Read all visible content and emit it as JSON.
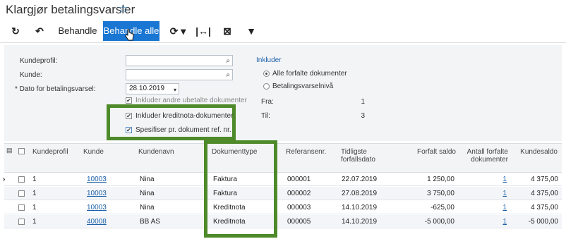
{
  "page": {
    "title": "Klargjør betalingsvarsler",
    "star_icon": "star-icon"
  },
  "toolbar": {
    "refresh_icon": "refresh-icon",
    "undo_icon": "undo-icon",
    "process_label": "Behandle",
    "process_all_label": "Behandle alle",
    "sync_icon": "sync-icon",
    "fit_icon": "fit-columns-icon",
    "export_icon": "export-excel-icon",
    "filter_icon": "filter-icon"
  },
  "form": {
    "customer_profile_label": "Kundeprofil:",
    "customer_label": "Kunde:",
    "date_label": "Dato for betalingsvarsel:",
    "date_value": "28.10.2019",
    "include_unpaid_label": "Inkluder andre ubetalte dokumenter",
    "include_credit_label": "Inkluder kreditnota-dokumenter",
    "specify_label": "Spesifiser pr. dokument ref. nr.",
    "include_heading": "Inkluder",
    "radio_all_label": "Alle forfalte dokumenter",
    "radio_level_label": "Betalingsvarselnivå",
    "from_label": "Fra:",
    "from_value": "1",
    "to_label": "Til:",
    "to_value": "3"
  },
  "grid": {
    "columns": [
      "Kundeprofil",
      "Kunde",
      "Kundenavn",
      "Dokumenttype",
      "Referansenr.",
      "Tidligste forfallsdato",
      "Forfalt saldo",
      "Antall forfalte dokumenter",
      "Kundesaldo"
    ],
    "rows": [
      {
        "profile": "1",
        "customer": "10003",
        "name": "Nina",
        "doctype": "Faktura",
        "ref": "000001",
        "date": "22.07.2019",
        "overdue": "1 250,00",
        "count": "1",
        "balance": "4 375,00"
      },
      {
        "profile": "1",
        "customer": "10003",
        "name": "Nina",
        "doctype": "Faktura",
        "ref": "000002",
        "date": "27.08.2019",
        "overdue": "3 750,00",
        "count": "1",
        "balance": "4 375,00"
      },
      {
        "profile": "1",
        "customer": "10003",
        "name": "Nina",
        "doctype": "Kreditnota",
        "ref": "000003",
        "date": "14.10.2019",
        "overdue": "-625,00",
        "count": "1",
        "balance": "4 375,00"
      },
      {
        "profile": "1",
        "customer": "40008",
        "name": "BB AS",
        "doctype": "Kreditnota",
        "ref": "000005",
        "date": "14.10.2019",
        "overdue": "-5 000,00",
        "count": "1",
        "balance": "-5 000,00"
      }
    ]
  },
  "colors": {
    "primary": "#1976d2",
    "highlight": "#4e8a2a",
    "link": "#1a5fa8"
  }
}
